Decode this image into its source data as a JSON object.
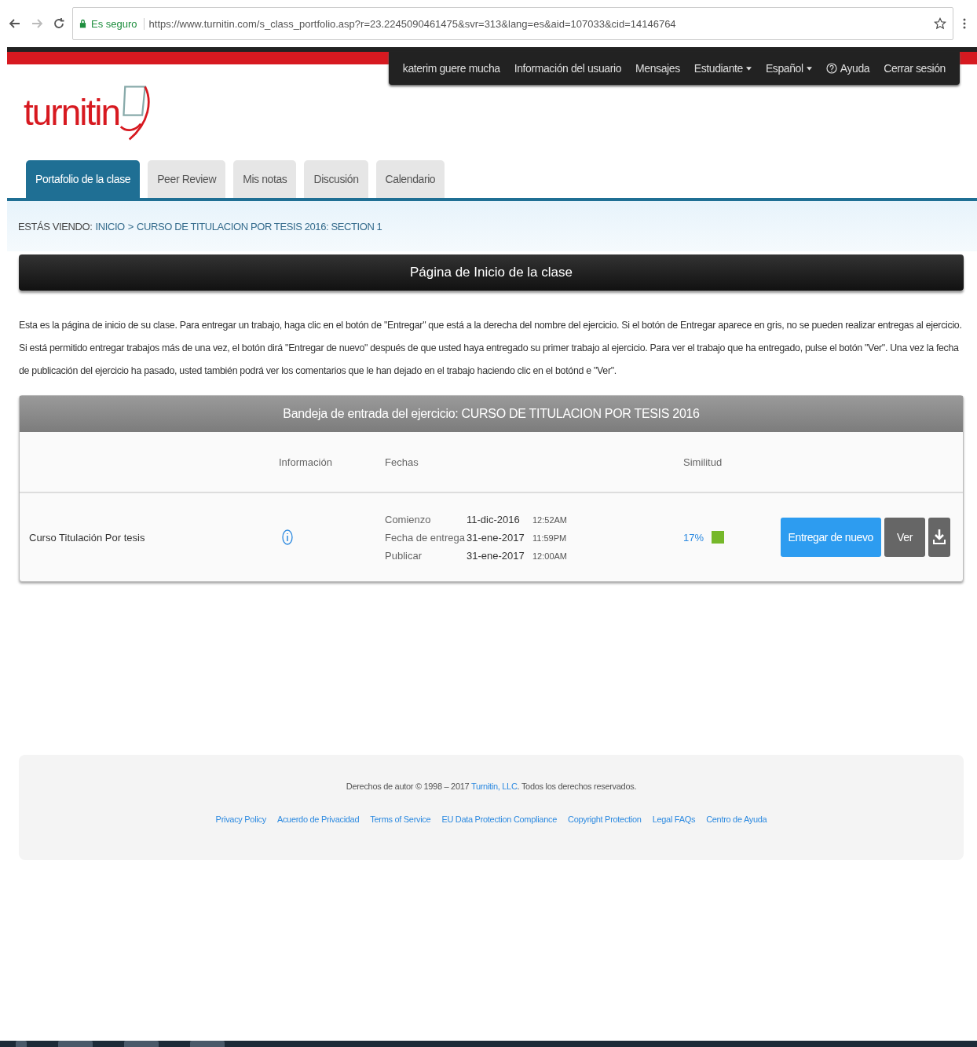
{
  "browser": {
    "secure_label": "Es seguro",
    "url": "https://www.turnitin.com/s_class_portfolio.asp?r=23.2245090461475&svr=313&lang=es&aid=107033&cid=14146764"
  },
  "user_nav": [
    {
      "label": "katerim guere mucha",
      "kind": "link"
    },
    {
      "label": "Información del usuario",
      "kind": "link"
    },
    {
      "label": "Mensajes",
      "kind": "link"
    },
    {
      "label": "Estudiante",
      "kind": "dropdown"
    },
    {
      "label": "Español",
      "kind": "dropdown"
    },
    {
      "label": "Ayuda",
      "kind": "help"
    },
    {
      "label": "Cerrar sesión",
      "kind": "link"
    }
  ],
  "logo": "turnitin",
  "tabs": [
    {
      "label": "Portafolio de la clase",
      "selected": true
    },
    {
      "label": "Peer Review",
      "selected": false
    },
    {
      "label": "Mis notas",
      "selected": false
    },
    {
      "label": "Discusión",
      "selected": false
    },
    {
      "label": "Calendario",
      "selected": false
    }
  ],
  "breadcrumb": {
    "label": "ESTÁS VIENDO:",
    "links": [
      "INICIO",
      "CURSO DE TITULACION POR TESIS 2016: SECTION 1"
    ],
    "separator": ">"
  },
  "page_title": "Página de Inicio de la clase",
  "intro": "Esta es la página de inicio de su clase. Para entregar un trabajo, haga clic en el botón de \"Entregar\" que está a la derecha del nombre del ejercicio. Si el botón de Entregar aparece en gris, no se pueden realizar entregas al ejercicio. Si está permitido entregar trabajos más de una vez, el botón dirá \"Entregar de nuevo\" después de que usted haya entregado su primer trabajo al ejercicio. Para ver el trabajo que ha entregado, pulse el botón \"Ver\". Una vez la fecha de publicación del ejercicio ha pasado, usted también podrá ver los comentarios que le han dejado en el trabajo haciendo clic en el botónd e \"Ver\".",
  "inbox": {
    "title": "Bandeja de entrada del ejercicio: CURSO DE TITULACION POR TESIS 2016",
    "columns": [
      "Información",
      "Fechas",
      "Similitud"
    ],
    "rows": [
      {
        "name": "Curso Titulación Por tesis",
        "dates": [
          {
            "label": "Comienzo",
            "date": "11-dic-2016",
            "time": "12:52AM"
          },
          {
            "label": "Fecha de entrega",
            "date": "31-ene-2017",
            "time": "11:59PM"
          },
          {
            "label": "Publicar",
            "date": "31-ene-2017",
            "time": "12:00AM"
          }
        ],
        "similarity": "17%",
        "buttons": [
          "Entregar de nuevo",
          "Ver"
        ]
      }
    ]
  },
  "footer": {
    "copyright_before": "Derechos de autor © 1998 – 2017 ",
    "copyright_link": "Turnitin, LLC",
    "copyright_after": ". Todos los derechos reservados.",
    "links": [
      "Privacy Policy",
      "Acuerdo de Privacidad",
      "Terms of Service",
      "EU Data Protection Compliance",
      "Copyright Protection",
      "Legal FAQs",
      "Centro de Ayuda"
    ]
  }
}
